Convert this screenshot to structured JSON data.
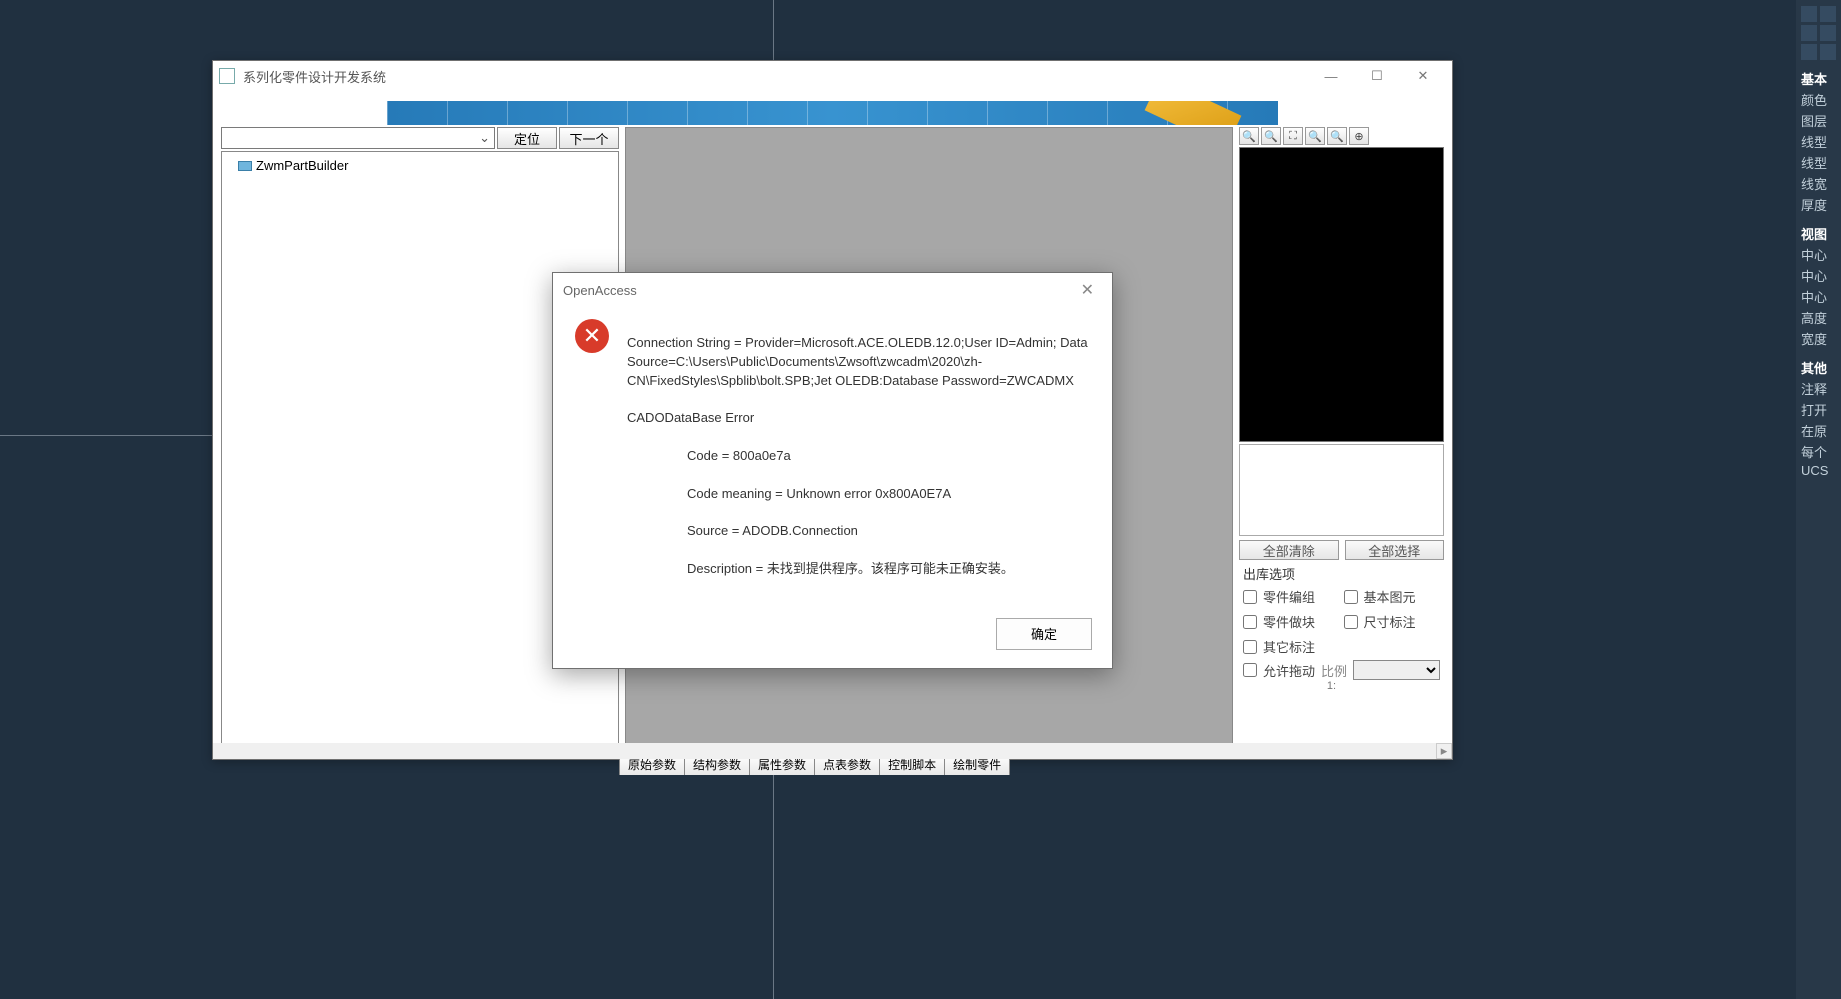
{
  "crosshair": true,
  "right_rail": {
    "items": [
      "基本",
      "颜色",
      "图层",
      "线型",
      "线型",
      "线宽",
      "厚度",
      "",
      "视图",
      "中心",
      "中心",
      "中心",
      "高度",
      "宽度",
      "",
      "其他",
      "注释",
      "打开",
      "在原",
      "每个",
      "UCS"
    ]
  },
  "child": {
    "title": "系列化零件设计开发系统",
    "combo_value": "",
    "btn_locate": "定位",
    "btn_next": "下一个",
    "tree_root": "ZwmPartBuilder",
    "mini_tools": [
      "🔍",
      "🔍",
      "⛶",
      "🔍",
      "🔍",
      "⊕"
    ],
    "btn_clear_all": "全部清除",
    "btn_select_all": "全部选择",
    "section_out": "出库选项",
    "checks": [
      {
        "label": "零件编组"
      },
      {
        "label": "基本图元"
      },
      {
        "label": "零件做块"
      },
      {
        "label": "尺寸标注"
      },
      {
        "label": "其它标注"
      },
      {
        "label": ""
      },
      {
        "label": "允许拖动"
      }
    ],
    "scale_label": "比例",
    "scale_value": "",
    "scale_under": "1:",
    "tabs": [
      "原始参数",
      "结构参数",
      "属性参数",
      "点表参数",
      "控制脚本",
      "绘制零件"
    ]
  },
  "dialog": {
    "title": "OpenAccess",
    "line1": "Connection String = Provider=Microsoft.ACE.OLEDB.12.0;User ID=Admin; Data Source=C:\\Users\\Public\\Documents\\Zwsoft\\zwcadm\\2020\\zh-CN\\FixedStyles\\Spblib\\bolt.SPB;Jet OLEDB:Database Password=ZWCADMX",
    "line2": "CADODataBase Error",
    "code": "Code = 800a0e7a",
    "meaning": "Code meaning = Unknown error 0x800A0E7A",
    "source": "Source = ADODB.Connection",
    "desc": "Description = 未找到提供程序。该程序可能未正确安装。",
    "ok": "确定"
  }
}
